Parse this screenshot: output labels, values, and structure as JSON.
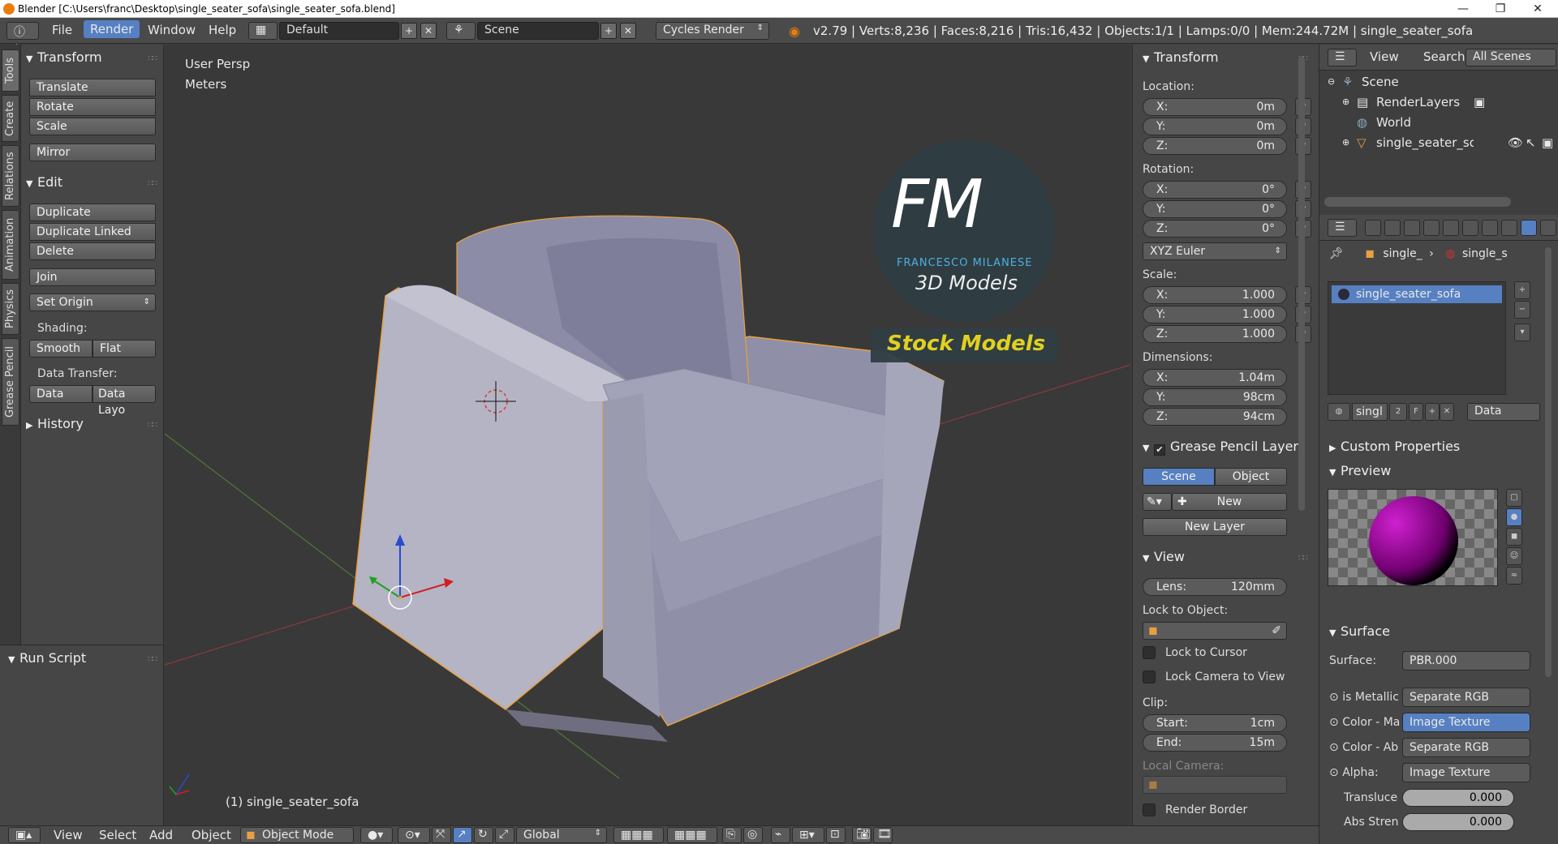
{
  "window": {
    "title": "Blender [C:\\Users\\franc\\Desktop\\single_seater_sofa\\single_seater_sofa.blend]"
  },
  "infobar": {
    "menus": [
      "File",
      "Render",
      "Window",
      "Help"
    ],
    "layout": "Default",
    "scene": "Scene",
    "engine": "Cycles Render",
    "stats": "v2.79 | Verts:8,236 | Faces:8,216 | Tris:16,432 | Objects:1/1 | Lamps:0/0 | Mem:244.72M | single_seater_sofa"
  },
  "left_tabs": [
    "Tools",
    "Create",
    "Relations",
    "Animation",
    "Physics",
    "Grease Pencil"
  ],
  "toolshelf": {
    "transform": {
      "title": "Transform",
      "buttons": [
        "Translate",
        "Rotate",
        "Scale",
        "Mirror"
      ]
    },
    "edit": {
      "title": "Edit",
      "buttons": [
        "Duplicate",
        "Duplicate Linked",
        "Delete",
        "Join",
        "Set Origin"
      ]
    },
    "shading_label": "Shading:",
    "shading": [
      "Smooth",
      "Flat"
    ],
    "data_transfer_label": "Data Transfer:",
    "data_transfer": [
      "Data",
      "Data Layo"
    ],
    "history": "History",
    "run_script": "Run Script"
  },
  "viewport": {
    "view_name": "User Persp",
    "units": "Meters",
    "object_label": "(1) single_seater_sofa",
    "watermark": {
      "initials": "FM",
      "name": "FRANCESCO MILANESE",
      "sub": "3D Models",
      "banner": "Stock Models"
    }
  },
  "npanel": {
    "transform_title": "Transform",
    "location_label": "Location:",
    "location": [
      {
        "k": "X:",
        "v": "0m"
      },
      {
        "k": "Y:",
        "v": "0m"
      },
      {
        "k": "Z:",
        "v": "0m"
      }
    ],
    "rotation_label": "Rotation:",
    "rotation": [
      {
        "k": "X:",
        "v": "0°"
      },
      {
        "k": "Y:",
        "v": "0°"
      },
      {
        "k": "Z:",
        "v": "0°"
      }
    ],
    "rotation_mode": "XYZ Euler",
    "scale_label": "Scale:",
    "scale": [
      {
        "k": "X:",
        "v": "1.000"
      },
      {
        "k": "Y:",
        "v": "1.000"
      },
      {
        "k": "Z:",
        "v": "1.000"
      }
    ],
    "dimensions_label": "Dimensions:",
    "dimensions": [
      {
        "k": "X:",
        "v": "1.04m"
      },
      {
        "k": "Y:",
        "v": "98cm"
      },
      {
        "k": "Z:",
        "v": "94cm"
      }
    ],
    "grease_title": "Grease Pencil Layer",
    "grease_tabs": [
      "Scene",
      "Object"
    ],
    "new_label": "New",
    "new_layer": "New Layer",
    "view_title": "View",
    "lens_k": "Lens:",
    "lens_v": "120mm",
    "lock_object_label": "Lock to Object:",
    "lock_cursor": "Lock to Cursor",
    "lock_camera": "Lock Camera to View",
    "clip_label": "Clip:",
    "clip_start_k": "Start:",
    "clip_start_v": "1cm",
    "clip_end_k": "End:",
    "clip_end_v": "15m",
    "local_camera": "Local Camera:",
    "render_border": "Render Border"
  },
  "outliner": {
    "menus": [
      "View",
      "Search"
    ],
    "filter": "All Scenes",
    "rows": [
      "Scene",
      "RenderLayers",
      "World",
      "single_seater_sofa"
    ]
  },
  "props": {
    "breadcrumb": [
      "single_",
      "single_s"
    ],
    "material_slot": "single_seater_sofa",
    "mat_name": "singl",
    "mat_users": "2",
    "mat_fake": "F",
    "mat_link": "Data",
    "custom_properties": "Custom Properties",
    "preview": "Preview",
    "surface_title": "Surface",
    "surface_rows": [
      {
        "label": "Surface:",
        "value": "PBR.000"
      },
      {
        "label": "is Metallic",
        "value": "Separate RGB"
      },
      {
        "label": "Color - Ma",
        "value": "Image Texture"
      },
      {
        "label": "Color - Ab",
        "value": "Separate RGB"
      },
      {
        "label": "Alpha:",
        "value": "Image Texture"
      }
    ],
    "translucent_label": "Transluce",
    "translucent_value": "0.000",
    "abs_label": "Abs Stren",
    "abs_value": "0.000"
  },
  "bottombar": {
    "menus": [
      "View",
      "Select",
      "Add",
      "Object"
    ],
    "mode": "Object Mode",
    "orientation": "Global"
  },
  "colors": {
    "accent": "#5680c2",
    "selection_outline": "#f0a030",
    "sofa": "#a7a7bc"
  }
}
